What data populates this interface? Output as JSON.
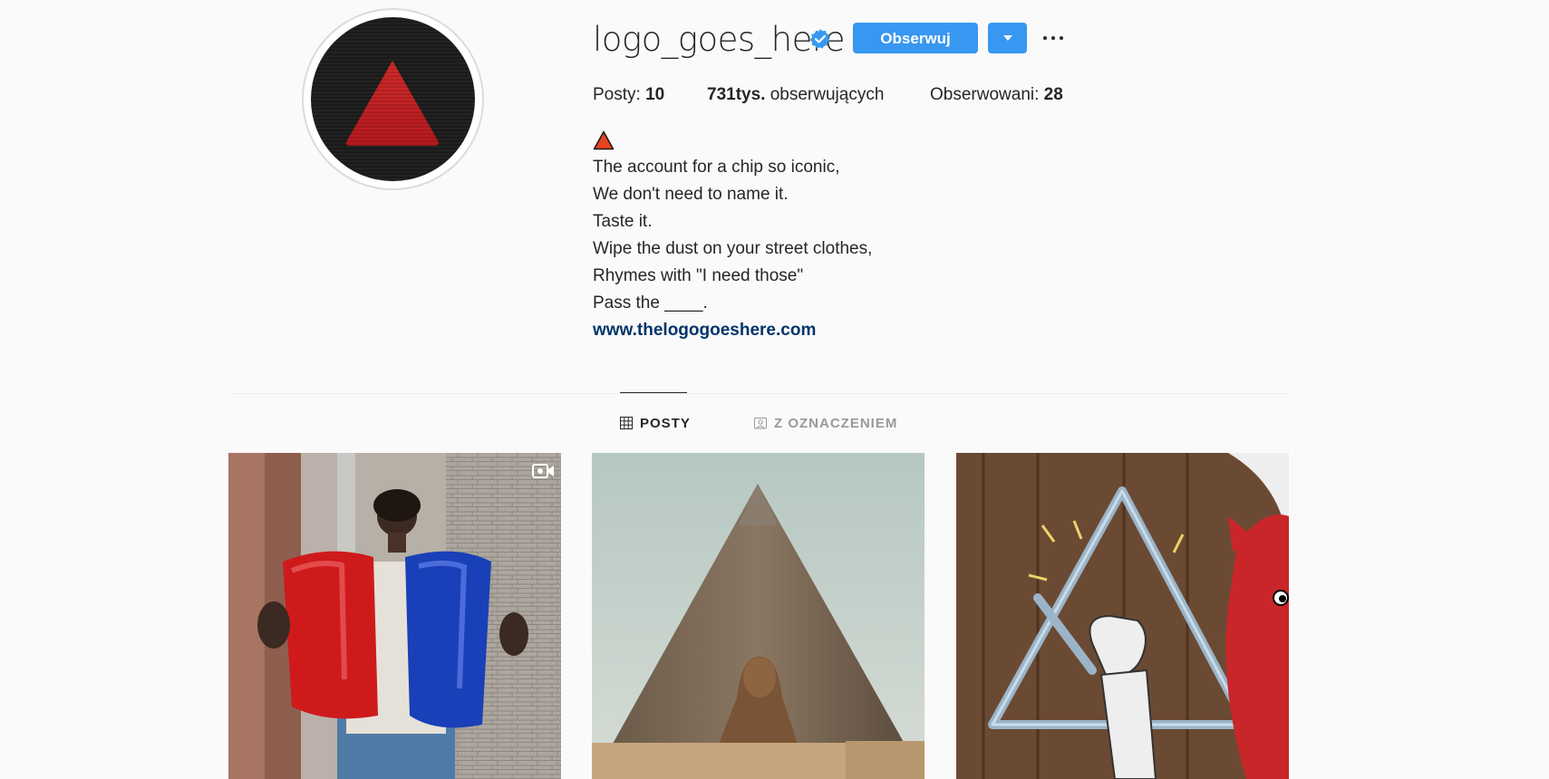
{
  "profile": {
    "username": "logo_goes_here",
    "verified": true,
    "follow_label": "Obserwuj",
    "stats": {
      "posts_label": "Posty:",
      "posts_value": "10",
      "followers_value": "731tys.",
      "followers_label": "obserwujących",
      "following_label": "Obserwowani:",
      "following_value": "28"
    },
    "bio": {
      "emoji": "red-triangle-icon",
      "lines": [
        "The account for a chip so iconic,",
        "We don't need to name it.",
        "Taste it.",
        "Wipe the dust on your street clothes,",
        "Rhymes with \"I need those\"",
        "Pass the ____."
      ],
      "link": "www.thelogogoeshere.com"
    }
  },
  "tabs": [
    {
      "label": "POSTY",
      "icon": "grid-icon",
      "active": true
    },
    {
      "label": "Z OZNACZENIEM",
      "icon": "tagged-icon",
      "active": false
    }
  ],
  "posts": [
    {
      "subject": "person-holding-chip-bags",
      "has_video": true
    },
    {
      "subject": "pyramid-and-sphinx",
      "has_video": false
    },
    {
      "subject": "cartoon-triangle-instrument",
      "has_video": false
    }
  ],
  "colors": {
    "accent": "#3897f0",
    "link": "#003569",
    "background": "#fafafa",
    "text": "#262626",
    "muted": "#999999"
  }
}
